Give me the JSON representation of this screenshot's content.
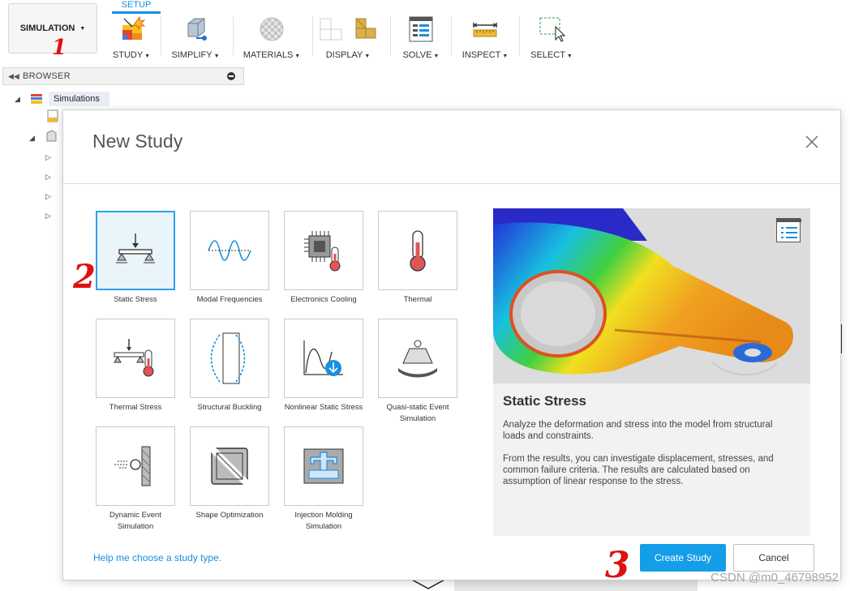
{
  "toolbar": {
    "workspace_label": "SIMULATION",
    "active_tab": "SETUP",
    "tools": [
      {
        "label": "STUDY",
        "icon": "study-icon"
      },
      {
        "label": "SIMPLIFY",
        "icon": "simplify-icon"
      },
      {
        "label": "MATERIALS",
        "icon": "materials-icon"
      },
      {
        "label": "DISPLAY",
        "icon": "display-icon"
      },
      {
        "label": "SOLVE",
        "icon": "solve-icon"
      },
      {
        "label": "INSPECT",
        "icon": "inspect-icon"
      },
      {
        "label": "SELECT",
        "icon": "select-icon"
      }
    ]
  },
  "browser": {
    "title": "BROWSER",
    "root_label": "Simulations"
  },
  "dialog": {
    "title": "New Study",
    "studies": [
      {
        "label": "Static Stress",
        "icon": "static-stress-icon",
        "selected": true
      },
      {
        "label": "Modal Frequencies",
        "icon": "modal-frequencies-icon"
      },
      {
        "label": "Electronics Cooling",
        "icon": "electronics-cooling-icon"
      },
      {
        "label": "Thermal",
        "icon": "thermal-icon"
      },
      {
        "label": "Thermal Stress",
        "icon": "thermal-stress-icon"
      },
      {
        "label": "Structural Buckling",
        "icon": "structural-buckling-icon"
      },
      {
        "label": "Nonlinear Static Stress",
        "icon": "nonlinear-static-stress-icon"
      },
      {
        "label": "Quasi-static Event Simulation",
        "icon": "quasi-static-event-icon"
      },
      {
        "label": "Dynamic Event Simulation",
        "icon": "dynamic-event-icon"
      },
      {
        "label": "Shape Optimization",
        "icon": "shape-optimization-icon"
      },
      {
        "label": "Injection Molding Simulation",
        "icon": "injection-molding-icon"
      }
    ],
    "preview": {
      "title": "Static Stress",
      "desc_1": "Analyze the deformation and stress into the model from structural loads and constraints.",
      "desc_2": "From the results, you can investigate displacement, stresses, and common failure criteria. The results are calculated based on assumption of linear response to the stress."
    },
    "help_link": "Help me choose a study type.",
    "create_label": "Create Study",
    "cancel_label": "Cancel"
  },
  "annotations": {
    "one": "1",
    "two": "2",
    "three": "3"
  },
  "watermark": "CSDN @m0_46798952",
  "colors": {
    "accent": "#159ee8",
    "annotation": "#e01010"
  }
}
